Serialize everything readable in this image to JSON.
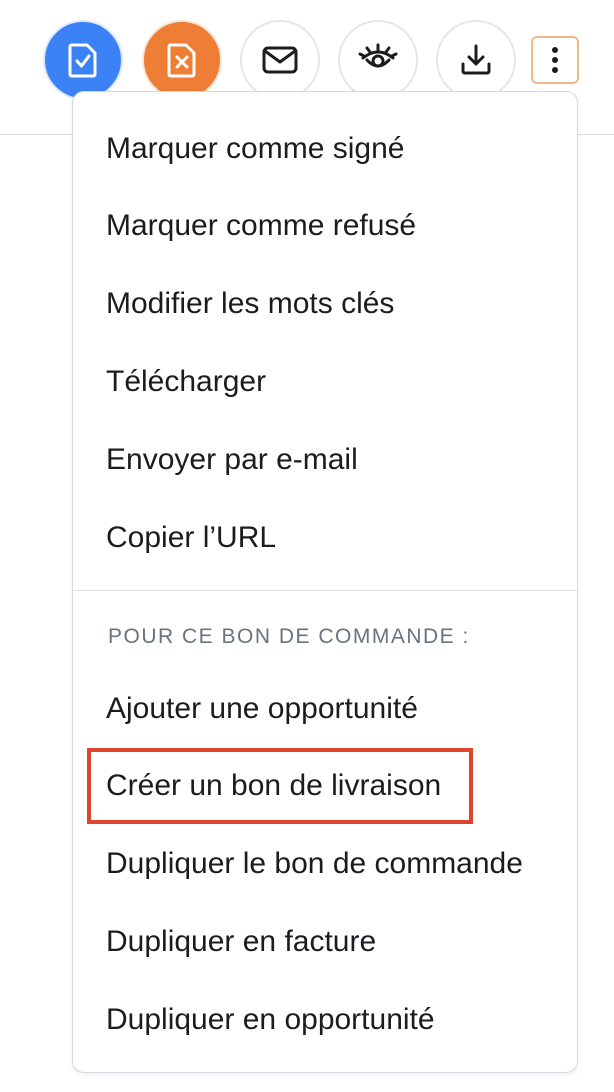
{
  "toolbar": {
    "buttons": [
      {
        "icon": "document-check-icon",
        "color": "#3b82f6"
      },
      {
        "icon": "document-x-icon",
        "color": "#ee7d36"
      },
      {
        "icon": "mail-icon"
      },
      {
        "icon": "eye-icon"
      },
      {
        "icon": "download-icon"
      },
      {
        "icon": "more-vertical-icon",
        "outline_color": "#f0b98a"
      }
    ]
  },
  "menu": {
    "items": [
      "Marquer comme signé",
      "Marquer comme refusé",
      "Modifier les mots clés",
      "Télécharger",
      "Envoyer par e-mail",
      "Copier l’URL"
    ],
    "section_label": "POUR CE BON DE COMMANDE :",
    "section_items": [
      "Ajouter une opportunité",
      "Créer un bon de livraison",
      "Dupliquer le bon de commande",
      "Dupliquer en facture",
      "Dupliquer en opportunité"
    ],
    "highlighted_item": "Créer un bon de livraison",
    "highlight_color": "#e0432e"
  }
}
